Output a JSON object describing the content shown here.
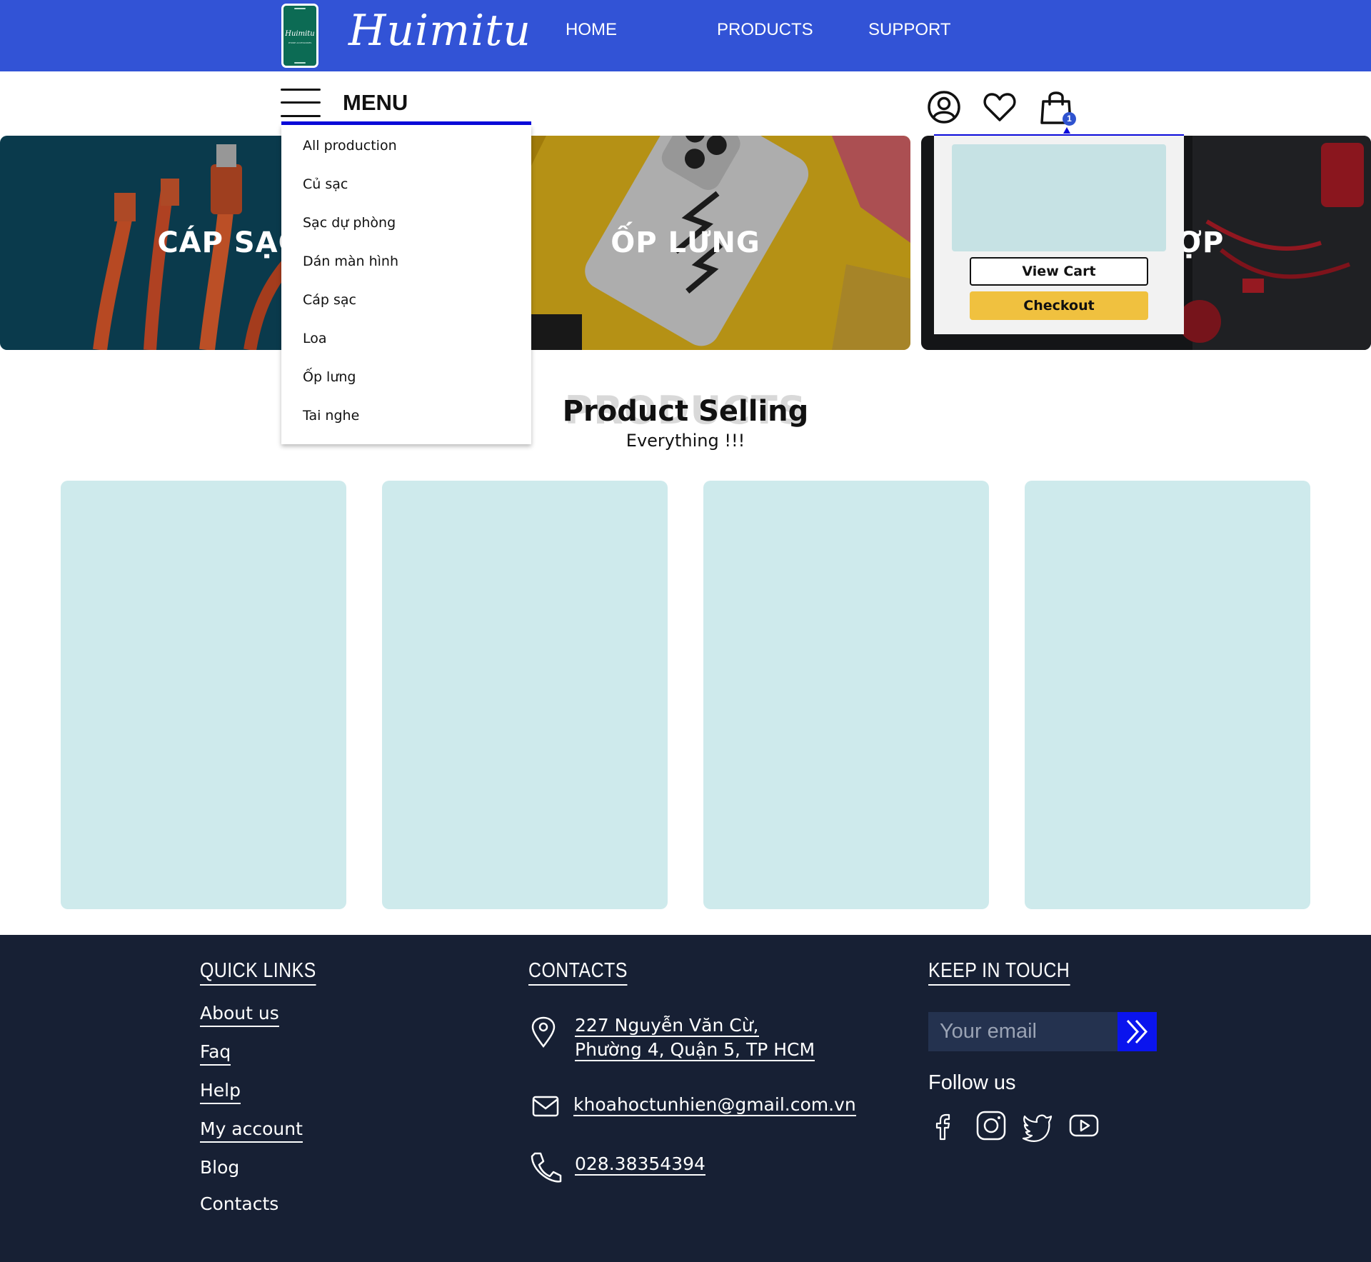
{
  "header": {
    "logo": {
      "name": "Huimitu",
      "tagline": "PHONE ACCESSORIES"
    },
    "brand": "Huimitu",
    "nav": [
      {
        "label": "HOME"
      },
      {
        "label": "PRODUCTS"
      },
      {
        "label": "SUPPORT"
      }
    ],
    "menu_label": "MENU",
    "cart_count": "1"
  },
  "menu": {
    "items": [
      {
        "label": "All production"
      },
      {
        "label": "Củ sạc"
      },
      {
        "label": "Sạc dự phòng"
      },
      {
        "label": "Dán màn hình"
      },
      {
        "label": "Cáp sạc"
      },
      {
        "label": "Loa"
      },
      {
        "label": "Ốp lưng"
      },
      {
        "label": "Tai nghe"
      }
    ]
  },
  "banners": [
    {
      "label": "CÁP SẠC"
    },
    {
      "label": "ỐP LƯNG"
    },
    {
      "label": "ỢP"
    }
  ],
  "cart_popup": {
    "view_cart": "View Cart",
    "checkout": "Checkout"
  },
  "products": {
    "ghost_title": "PRODUCTS",
    "title": "Product Selling",
    "subtitle": "Everything !!!"
  },
  "footer": {
    "quick_links": {
      "heading": "QUICK LINKS",
      "items": [
        {
          "label": "About us"
        },
        {
          "label": "Faq"
        },
        {
          "label": "Help"
        },
        {
          "label": "My account"
        },
        {
          "label": "Blog"
        },
        {
          "label": "Contacts"
        }
      ]
    },
    "contacts": {
      "heading": "CONTACTS",
      "address_line1": "227 Nguyễn Văn Cừ,",
      "address_line2": "Phường 4, Quận 5, TP HCM",
      "email": "khoahoctunhien@gmail.com.vn",
      "phone": "028.38354394"
    },
    "keep_in_touch": {
      "heading": "KEEP IN TOUCH",
      "email_placeholder": "Your email",
      "follow_label": "Follow us",
      "social": [
        "facebook-icon",
        "instagram-icon",
        "twitter-icon",
        "youtube-icon"
      ]
    }
  },
  "colors": {
    "topbar": "#3253d6",
    "accent_blue": "#0a0adb",
    "checkout_yellow": "#f0c13f",
    "card_placeholder": "#ceeaec",
    "footer_bg": "#172034"
  }
}
